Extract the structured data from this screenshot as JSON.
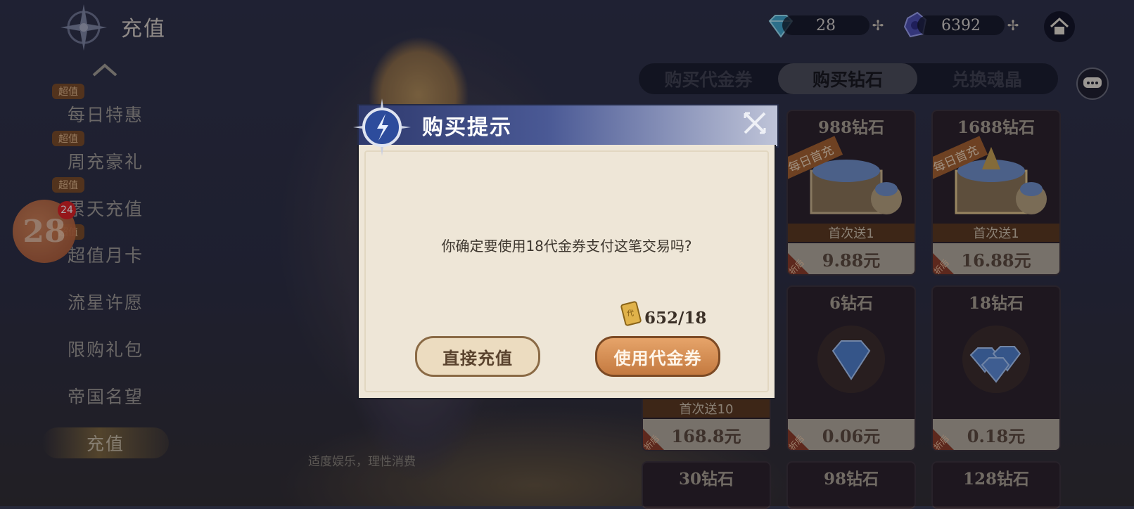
{
  "header": {
    "title": "充值"
  },
  "currencies": [
    {
      "name": "diamond",
      "value": "28",
      "icon": "diamond-icon"
    },
    {
      "name": "soul-crystal",
      "value": "6392",
      "icon": "crystal-icon"
    }
  ],
  "tabs": [
    {
      "label": "购买代金券",
      "active": false
    },
    {
      "label": "购买钻石",
      "active": true
    },
    {
      "label": "兑换魂晶",
      "active": false
    }
  ],
  "sidebar": {
    "badge": "超值",
    "items": [
      {
        "label": "每日特惠",
        "badge": true
      },
      {
        "label": "周充豪礼",
        "badge": true
      },
      {
        "label": "累天充值",
        "badge": true
      },
      {
        "label": "超值月卡",
        "badge": true
      },
      {
        "label": "流星许愿",
        "badge": false
      },
      {
        "label": "限购礼包",
        "badge": false
      },
      {
        "label": "帝国名望",
        "badge": false
      },
      {
        "label": "充值",
        "badge": false,
        "active": true
      }
    ]
  },
  "floating": {
    "number": "28",
    "notification": "24"
  },
  "disclaimer": "适度娱乐，理性消费",
  "cards": [
    {
      "name": "988钻石",
      "bonus": "首次送1",
      "price": "9.88元",
      "ribbon": "每日首充",
      "discount": "折后"
    },
    {
      "name": "1688钻石",
      "bonus": "首次送1",
      "price": "16.88元",
      "ribbon": "每日首充",
      "discount": "折后"
    },
    {
      "name": "",
      "bonus": "首次送10",
      "price": "168.8元",
      "ribbon": "",
      "discount": "折后"
    },
    {
      "name": "6钻石",
      "bonus": "",
      "price": "0.06元",
      "ribbon": "",
      "discount": "折后"
    },
    {
      "name": "18钻石",
      "bonus": "",
      "price": "0.18元",
      "ribbon": "",
      "discount": "折后"
    },
    {
      "name": "30钻石",
      "bonus": "",
      "price": "",
      "ribbon": "",
      "discount": ""
    },
    {
      "name": "98钻石",
      "bonus": "",
      "price": "",
      "ribbon": "",
      "discount": ""
    },
    {
      "name": "128钻石",
      "bonus": "",
      "price": "",
      "ribbon": "",
      "discount": ""
    }
  ],
  "dialog": {
    "title": "购买提示",
    "message": "你确定要使用18代金券支付这笔交易吗?",
    "voucher_count": "652/18",
    "btn_charge": "直接充值",
    "btn_voucher": "使用代金券"
  },
  "colors": {
    "accent": "#c47a40",
    "dialog_header": "#4a5995",
    "notification": "#e02020"
  }
}
